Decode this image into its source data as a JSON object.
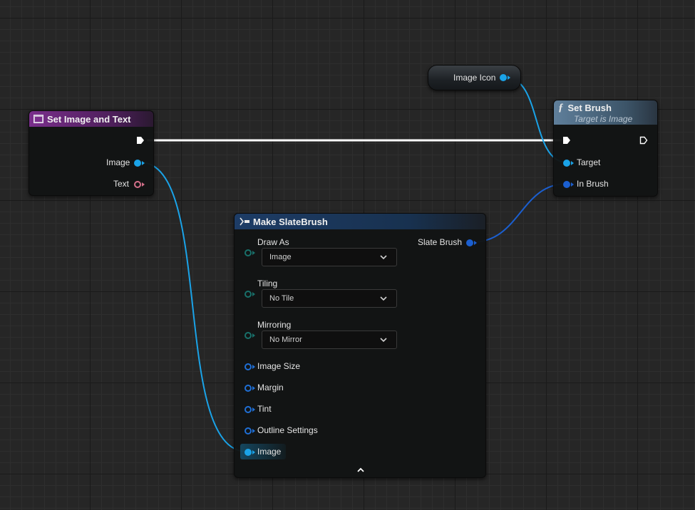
{
  "graph": {
    "variable_node": {
      "pin_label": "Image Icon"
    },
    "event_node": {
      "title": "Set Image and Text",
      "pins": {
        "image": "Image",
        "text": "Text"
      }
    },
    "set_brush_node": {
      "title": "Set Brush",
      "subtitle": "Target is Image",
      "pins": {
        "target": "Target",
        "in_brush": "In Brush"
      }
    },
    "make_brush_node": {
      "title": "Make SlateBrush",
      "output_label": "Slate Brush",
      "draw_as": {
        "label": "Draw As",
        "value": "Image"
      },
      "tiling": {
        "label": "Tiling",
        "value": "No Tile"
      },
      "mirroring": {
        "label": "Mirroring",
        "value": "No Mirror"
      },
      "pins": {
        "image_size": "Image Size",
        "margin": "Margin",
        "tint": "Tint",
        "outline_settings": "Outline Settings",
        "image": "Image"
      }
    }
  },
  "colors": {
    "object_pin": "#1aa3e8",
    "struct_pin": "#1b5fd0",
    "exec_wire": "#ffffff",
    "text_pin": "#d4708a",
    "event_header": "#7a2f8c",
    "function_header": "#5f7f9b",
    "make_header": "#1d3c66"
  }
}
